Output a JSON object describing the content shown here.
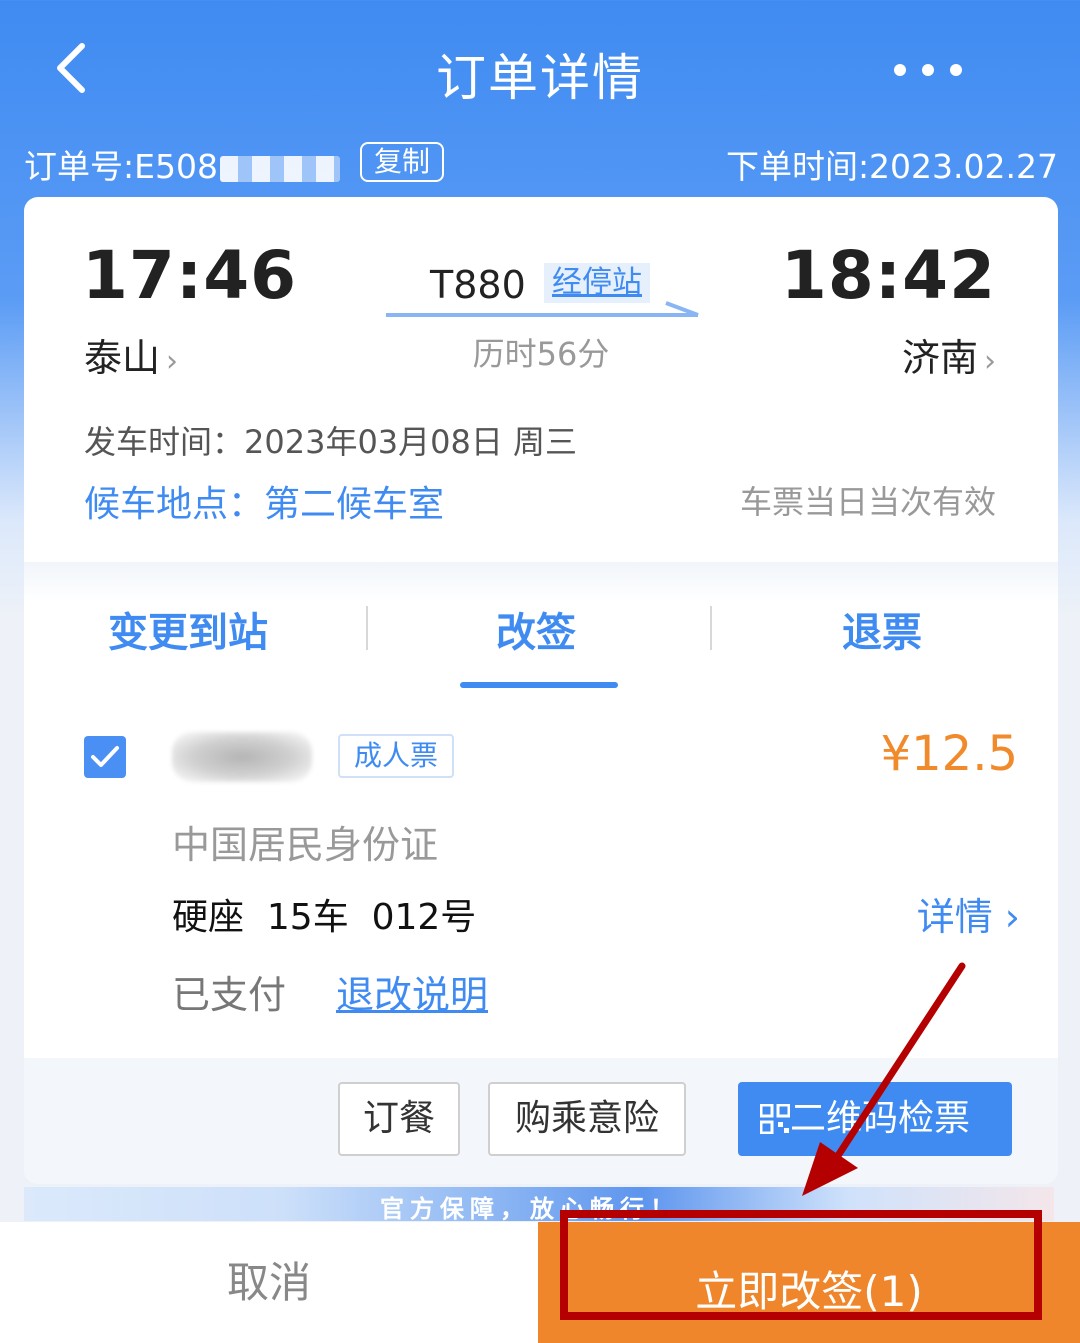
{
  "nav": {
    "title": "订单详情"
  },
  "order": {
    "number_label": "订单号:E508",
    "copy_label": "复制",
    "order_time": "下单时间:2023.02.27"
  },
  "trip": {
    "dep_time": "17:46",
    "arr_time": "18:42",
    "dep_station": "泰山",
    "arr_station": "济南",
    "train_no": "T880",
    "stops_label": "经停站",
    "duration": "历时56分",
    "dep_date": "发车时间：2023年03月08日 周三",
    "waiting_room": "候车地点：第二候车室",
    "validity": "车票当日当次有效"
  },
  "tabs": [
    {
      "label": "变更到站"
    },
    {
      "label": "改签",
      "active": true
    },
    {
      "label": "退票"
    }
  ],
  "passenger": {
    "checked": true,
    "ticket_type": "成人票",
    "price": "¥12.5",
    "id_type": "中国居民身份证",
    "seat": "硬座  15车  012号",
    "detail_label": "详情",
    "pay_status": "已支付",
    "rules_label": "退改说明"
  },
  "actions": {
    "meal": "订餐",
    "insurance": "购乘意险",
    "qr_check": "二维码检票"
  },
  "banner": {
    "text": "官方保障，放心畅行！"
  },
  "bottom": {
    "cancel": "取消",
    "confirm": "立即改签(1)"
  },
  "colors": {
    "primary": "#3f8bf2",
    "price": "#f08a2a",
    "confirm": "#f0862b",
    "annotation": "#b40000"
  }
}
